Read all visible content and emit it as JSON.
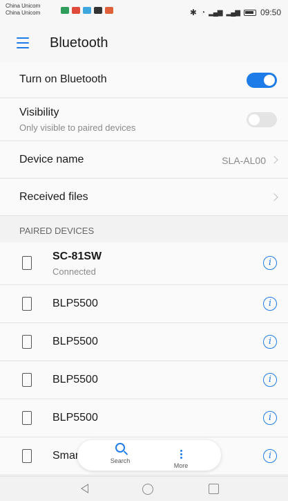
{
  "statusbar": {
    "carrier1": "China Unicom",
    "carrier2": "China Unicom",
    "time": "09:50"
  },
  "appbar": {
    "title": "Bluetooth"
  },
  "settings": {
    "turn_on_label": "Turn on Bluetooth",
    "turn_on_state": true,
    "visibility_label": "Visibility",
    "visibility_sub": "Only visible to paired devices",
    "visibility_state": false,
    "device_name_label": "Device name",
    "device_name_value": "SLA-AL00",
    "received_files_label": "Received files"
  },
  "paired": {
    "header": "PAIRED DEVICES",
    "devices": [
      {
        "name": "SC-81SW",
        "status": "Connected"
      },
      {
        "name": "BLP5500"
      },
      {
        "name": "BLP5500"
      },
      {
        "name": "BLP5500"
      },
      {
        "name": "BLP5500"
      },
      {
        "name": "Smar"
      }
    ]
  },
  "actions": {
    "search_label": "Search",
    "more_label": "More"
  },
  "colors": {
    "accent": "#1e7ce8"
  }
}
